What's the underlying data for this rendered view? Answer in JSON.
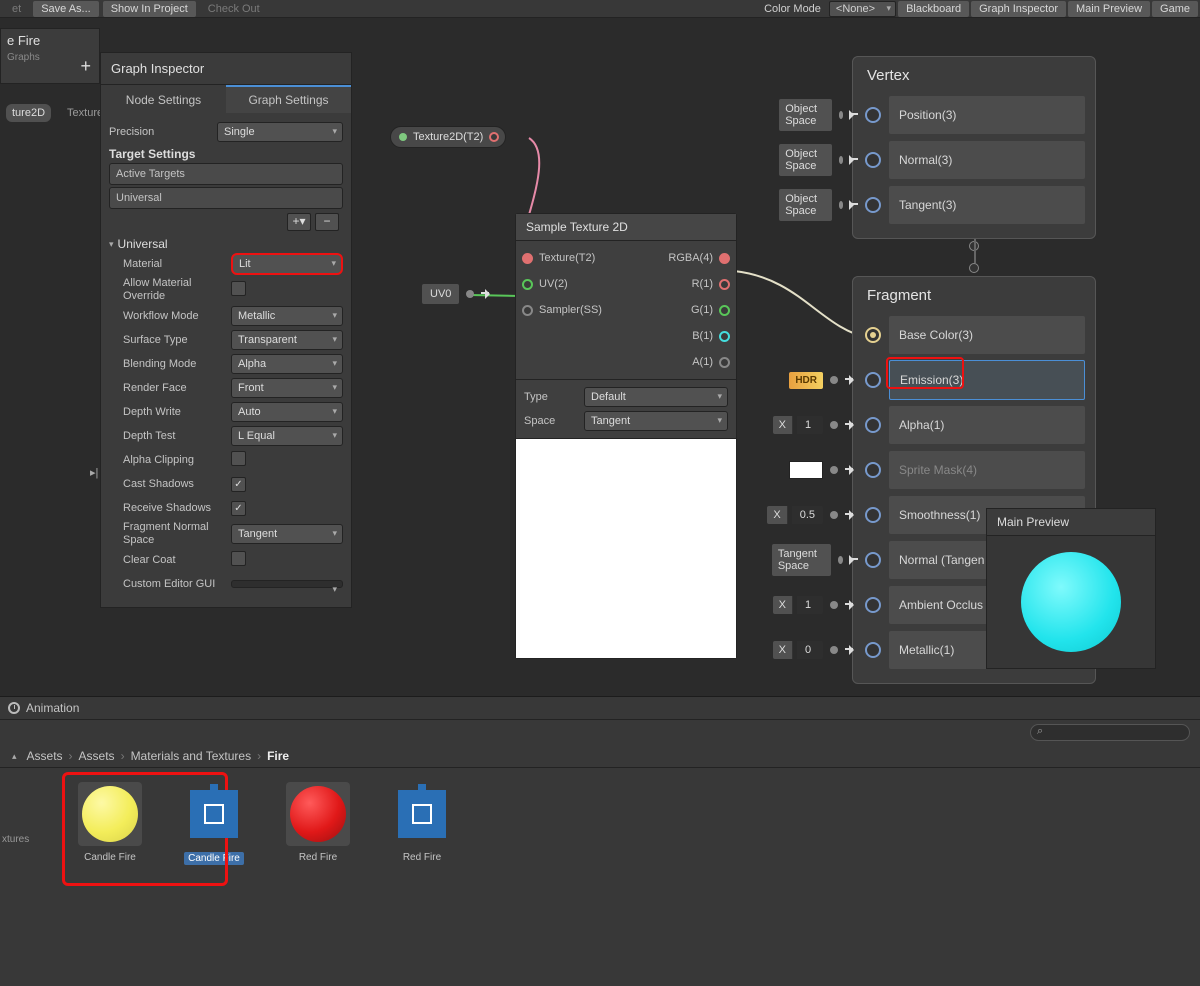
{
  "toolbar": {
    "left": [
      "et",
      "Save As...",
      "Show In Project",
      "Check Out"
    ],
    "color_mode_label": "Color Mode",
    "color_mode_value": "<None>",
    "right": [
      "Blackboard",
      "Graph Inspector",
      "Main Preview",
      "Game"
    ]
  },
  "shader_panel": {
    "title": "e Fire",
    "subtitle": "Graphs"
  },
  "tex_tabs": [
    "ture2D",
    "Texture"
  ],
  "inspector": {
    "title": "Graph Inspector",
    "tabs": {
      "node": "Node Settings",
      "graph": "Graph Settings"
    },
    "precision_label": "Precision",
    "precision_value": "Single",
    "target_settings": "Target Settings",
    "active_targets": "Active Targets",
    "target_item": "Universal",
    "foldout": "Universal",
    "props": {
      "material": {
        "label": "Material",
        "value": "Lit"
      },
      "allow_override": {
        "label": "Allow Material Override"
      },
      "workflow": {
        "label": "Workflow Mode",
        "value": "Metallic"
      },
      "surface": {
        "label": "Surface Type",
        "value": "Transparent"
      },
      "blending": {
        "label": "Blending Mode",
        "value": "Alpha"
      },
      "render_face": {
        "label": "Render Face",
        "value": "Front"
      },
      "depth_write": {
        "label": "Depth Write",
        "value": "Auto"
      },
      "depth_test": {
        "label": "Depth Test",
        "value": "L Equal"
      },
      "alpha_clip": {
        "label": "Alpha Clipping"
      },
      "cast_shadows": {
        "label": "Cast Shadows",
        "checked": true
      },
      "receive_shadows": {
        "label": "Receive Shadows",
        "checked": true
      },
      "frag_normal": {
        "label": "Fragment Normal Space",
        "value": "Tangent"
      },
      "clear_coat": {
        "label": "Clear Coat"
      },
      "custom_gui": {
        "label": "Custom Editor GUI"
      }
    }
  },
  "tex_node": "Texture2D(T2)",
  "uv_chip": "UV0",
  "sample_node": {
    "title": "Sample Texture 2D",
    "in": [
      "Texture(T2)",
      "UV(2)",
      "Sampler(SS)"
    ],
    "out": [
      "RGBA(4)",
      "R(1)",
      "G(1)",
      "B(1)",
      "A(1)"
    ],
    "type_label": "Type",
    "type_value": "Default",
    "space_label": "Space",
    "space_value": "Tangent"
  },
  "vertex": {
    "title": "Vertex",
    "slots": [
      {
        "tag": "Object Space",
        "label": "Position(3)"
      },
      {
        "tag": "Object Space",
        "label": "Normal(3)"
      },
      {
        "tag": "Object Space",
        "label": "Tangent(3)"
      }
    ]
  },
  "fragment": {
    "title": "Fragment",
    "slots": {
      "base_color": "Base Color(3)",
      "emission": "Emission(3)",
      "alpha": "Alpha(1)",
      "sprite_mask": "Sprite Mask(4)",
      "smoothness": "Smoothness(1)",
      "normal": "Normal (Tangen",
      "ao": "Ambient Occlus",
      "metallic": "Metallic(1)"
    },
    "chips": {
      "hdr": "HDR",
      "alpha_val": "1",
      "smooth_val": "0.5",
      "normal_tag": "Tangent Space",
      "ao_val": "1",
      "metallic_val": "0",
      "x": "X"
    }
  },
  "main_preview": "Main Preview",
  "bottom": {
    "animation": "Animation",
    "breadcrumb": [
      "Assets",
      "Assets",
      "Materials and Textures",
      "Fire"
    ],
    "side_label": "xtures",
    "assets": [
      {
        "name": "Candle Fire",
        "kind": "mat",
        "color": "#f3ed5a"
      },
      {
        "name": "Candle Fire",
        "kind": "sg",
        "selected": true
      },
      {
        "name": "Red Fire",
        "kind": "mat",
        "color": "#e01818"
      },
      {
        "name": "Red Fire",
        "kind": "sg"
      }
    ]
  }
}
